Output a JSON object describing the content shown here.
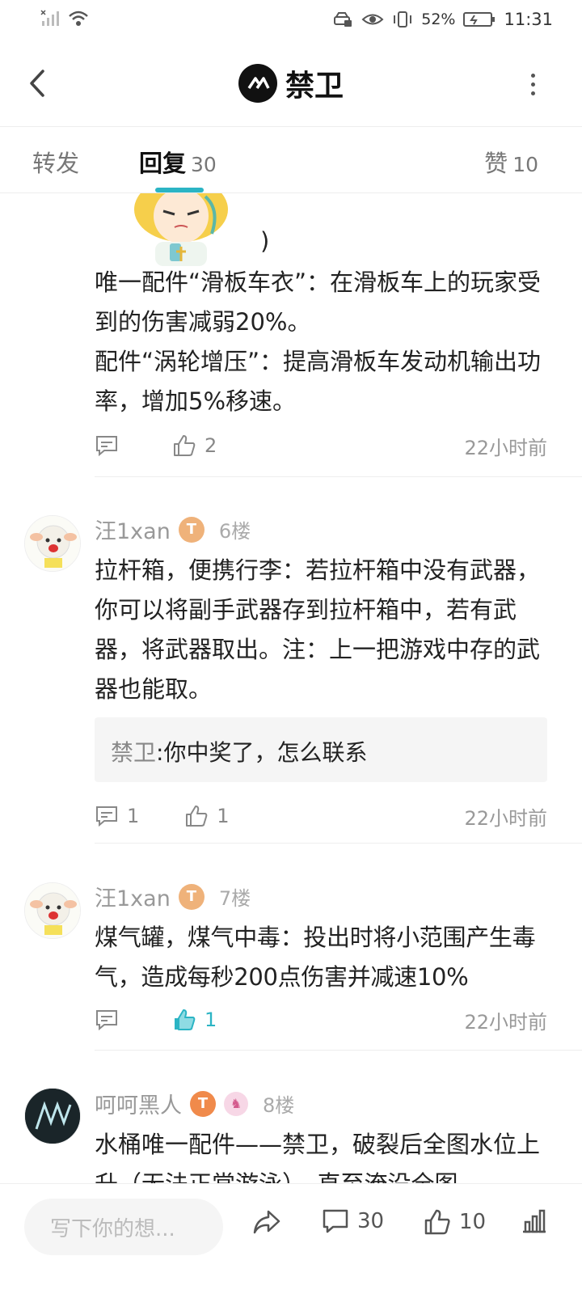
{
  "status_bar": {
    "battery": "52%",
    "time": "11:31"
  },
  "header": {
    "title": "禁卫"
  },
  "tabs": {
    "forward": {
      "label": "转发"
    },
    "reply": {
      "label": "回复",
      "count": "30"
    },
    "like": {
      "label": "赞",
      "count": "10"
    }
  },
  "comments": [
    {
      "trailing": ")",
      "text": "唯一配件“滑板车衣”：在滑板车上的玩家受到的伤害减弱20%。\n配件“涡轮增压”：提高滑板车发动机输出功率，增加5%移速。",
      "reply_count": "",
      "like_count": "2",
      "time": "22小时前"
    },
    {
      "username": "汪1xan",
      "floor": "6楼",
      "text": "拉杆箱，便携行李：若拉杆箱中没有武器，你可以将副手武器存到拉杆箱中，若有武器，将武器取出。注：上一把游戏中存的武器也能取。",
      "quote_name": "禁卫",
      "quote_text": ":你中奖了，怎么联系",
      "reply_count": "1",
      "like_count": "1",
      "time": "22小时前"
    },
    {
      "username": "汪1xan",
      "floor": "7楼",
      "text": "煤气罐，煤气中毒：投出时将小范围产生毒气，造成每秒200点伤害并减速10%",
      "reply_count": "",
      "like_count": "1",
      "time": "22小时前"
    },
    {
      "username": "呵呵黑人",
      "floor": "8楼",
      "text": "水桶唯一配件——禁卫，破裂后全图水位上升（无法正常游泳），直至淹没全图"
    }
  ],
  "bottom_bar": {
    "input_placeholder": "写下你的想...",
    "comment_count": "30",
    "like_count": "10"
  },
  "colors": {
    "accent": "#2bb4c4",
    "badge": "#efb27a"
  }
}
